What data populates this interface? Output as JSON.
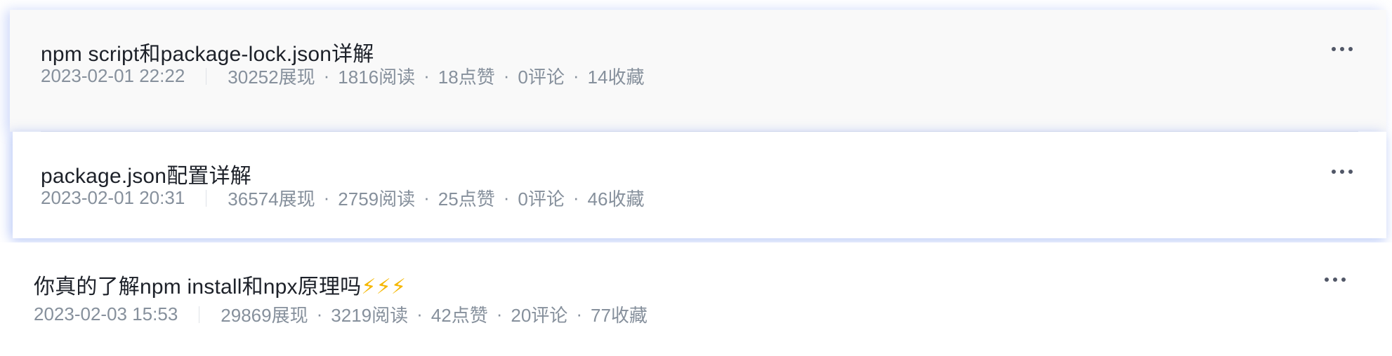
{
  "articles": [
    {
      "title": "npm script和package-lock.json详解",
      "time": "2023-02-01 22:22",
      "stats": [
        "30252展现",
        "1816阅读",
        "18点赞",
        "0评论",
        "14收藏"
      ]
    },
    {
      "title": "package.json配置详解",
      "time": "2023-02-01 20:31",
      "stats": [
        "36574展现",
        "2759阅读",
        "25点赞",
        "0评论",
        "46收藏"
      ]
    },
    {
      "title": "你真的了解npm install和npx原理吗",
      "title_emoji": "⚡⚡⚡",
      "time": "2023-02-03 15:53",
      "stats": [
        "29869展现",
        "3219阅读",
        "42点赞",
        "20评论",
        "77收藏"
      ]
    }
  ],
  "icons": {
    "more": "more-icon",
    "lightning": "lightning-icon"
  },
  "colors": {
    "title": "#1d2129",
    "meta": "#86909c",
    "hover_bg": "#f9f9f9",
    "shadow_accent": "#7896f0",
    "emoji": "#f5b700"
  }
}
